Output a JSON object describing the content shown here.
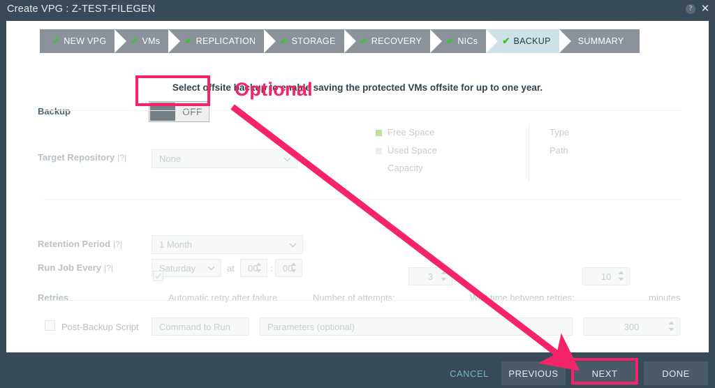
{
  "window": {
    "title": "Create VPG : Z-TEST-FILEGEN",
    "help_icon": "help-circle-icon",
    "close_icon": "close-icon"
  },
  "wizard": {
    "steps": [
      {
        "label": "NEW VPG",
        "check": "✔",
        "active": false
      },
      {
        "label": "VMs",
        "check": "✔",
        "active": false
      },
      {
        "label": "REPLICATION",
        "check": "✔",
        "active": false
      },
      {
        "label": "STORAGE",
        "check": "✔",
        "active": false
      },
      {
        "label": "RECOVERY",
        "check": "✔",
        "active": false
      },
      {
        "label": "NICs",
        "check": "✔",
        "active": false
      },
      {
        "label": "BACKUP",
        "check": "✔",
        "active": true
      },
      {
        "label": "SUMMARY",
        "check": "",
        "active": false
      }
    ]
  },
  "main": {
    "intro_message": "Select offsite backup to enable saving the protected VMs offsite for up to one year.",
    "backup": {
      "label": "Backup",
      "toggle_state": "OFF"
    },
    "target_repository": {
      "label": "Target Repository",
      "help": "|?|",
      "value": "None"
    },
    "repo_stats": {
      "free_space": "Free Space",
      "used_space": "Used Space",
      "capacity": "Capacity",
      "type": "Type",
      "path": "Path",
      "free_space_color": "#b9e3a1",
      "used_space_color": "#eceff0"
    },
    "retention_period": {
      "label": "Retention Period",
      "help": "|?|",
      "value": "1 Month"
    },
    "run_job_every": {
      "label": "Run Job Every",
      "help": "|?|",
      "day": "Saturday",
      "at": "at",
      "hour": "00",
      "separator": ":",
      "minute": "00"
    },
    "retries": {
      "label": "Retries",
      "auto_retry_label": "Automatic retry after failure",
      "auto_retry_checked": true,
      "attempts_label": "Number of attempts:",
      "attempts_value": "3",
      "wait_label": "Wait time between retries:",
      "wait_value": "10",
      "wait_unit": "minutes"
    },
    "post_backup_script": {
      "label": "Post-Backup Script",
      "checked": false,
      "command_placeholder": "Command to Run",
      "params_placeholder": "Parameters (optional)",
      "timeout_value": "300"
    }
  },
  "footer": {
    "cancel": "CANCEL",
    "previous": "PREVIOUS",
    "next": "NEXT",
    "done": "DONE"
  },
  "annotations": {
    "optional_label": "Optional",
    "highlight_color": "#f5246a",
    "arrow": "points from the Backup toggle down-right to the NEXT button"
  },
  "colors": {
    "chrome": "#374a56",
    "panel": "#ffffff",
    "step_inactive": "#8b9299",
    "step_active": "#cfe1e8",
    "check_green": "#36c72b",
    "cancel_link": "#6fb9c4",
    "button": "#4a5b67",
    "accent_pink": "#f5246a"
  }
}
